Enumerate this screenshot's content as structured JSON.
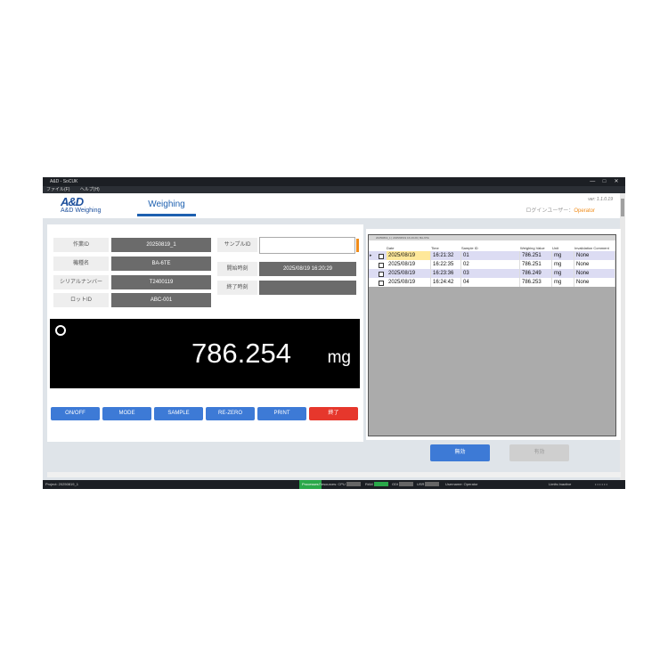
{
  "window": {
    "title": "A&D - SoCUK",
    "controls": [
      "—",
      "□",
      "✕"
    ]
  },
  "menu": [
    "ファイル(F)",
    "ヘルプ(H)"
  ],
  "header": {
    "logo_mark": "A&D",
    "logo_sub": "A&D Weighing",
    "tab": "Weighing",
    "version": "ver: 1.1.0.19",
    "login_label": "ログインユーザー：",
    "login_user": "Operator"
  },
  "form": {
    "job_id_label": "作業ID",
    "job_id": "20250819_1",
    "model_label": "機種名",
    "model": "BA-6TE",
    "serial_label": "シリアルナンバー",
    "serial": "T2400119",
    "lot_label": "ロットID",
    "lot": "ABC-001",
    "sample_label": "サンプルID",
    "sample_value": "",
    "start_label": "開始時刻",
    "start_time": "2025/08/19 16:20:29",
    "end_label": "終了時刻",
    "end_time": ""
  },
  "display": {
    "value": "786.254",
    "unit": "mg"
  },
  "buttons": {
    "onoff": "ON/OFF",
    "mode": "MODE",
    "sample": "SAMPLE",
    "rezero": "RE-ZERO",
    "print": "PRINT",
    "finish": "終了"
  },
  "table": {
    "strip_text": "20250819_1 | 2025/08/19 16:20:29 | BA-6TE",
    "columns": [
      "Date",
      "Time",
      "Sample ID",
      "Weighing Value",
      "Unit",
      "Invalidation Comment"
    ],
    "rows": [
      {
        "date": "2025/08/19",
        "time": "16:21:32",
        "sample": "01",
        "value": "786.251",
        "unit": "mg",
        "comment": "None"
      },
      {
        "date": "2025/08/19",
        "time": "16:22:35",
        "sample": "02",
        "value": "786.251",
        "unit": "mg",
        "comment": "None"
      },
      {
        "date": "2025/08/19",
        "time": "16:23:36",
        "sample": "03",
        "value": "786.249",
        "unit": "mg",
        "comment": "None"
      },
      {
        "date": "2025/08/19",
        "time": "16:24:42",
        "sample": "04",
        "value": "786.253",
        "unit": "mg",
        "comment": "None"
      }
    ]
  },
  "actions": {
    "valid": "無効",
    "invalid": "有効"
  },
  "status": {
    "project": "Project: 20250819_1",
    "process": "Processes",
    "resources": "Resources: CPU",
    "ram": "RAM",
    "gdi": "GDI",
    "usr": "USR",
    "username": "Username: Operator",
    "limits": "Limits Inactive",
    "dots": "• • • • • •"
  },
  "colors": {
    "accent": "#3d7ad6",
    "danger": "#e6372c",
    "login_user": "#f08c1a"
  }
}
